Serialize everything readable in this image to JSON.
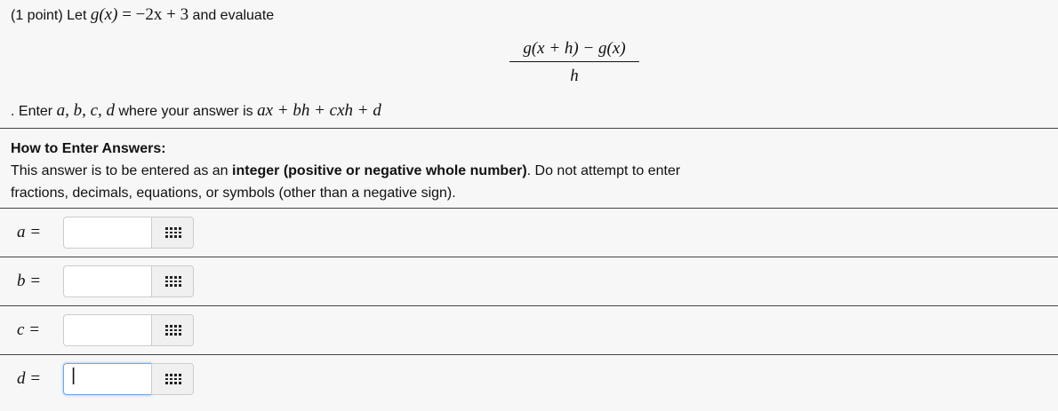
{
  "problem": {
    "points": "(1 point)",
    "let": " Let ",
    "g_x": "g(x)",
    "eq": " = −2x + 3",
    "evaluate": " and evaluate",
    "numerator": "g(x + h) − g(x)",
    "denominator": "h",
    "enter_prefix": ". Enter ",
    "vars": "a, b, c, d",
    "where": " where your answer is ",
    "expr": "ax + bh + cxh + d"
  },
  "howto": {
    "title": "How to Enter Answers:",
    "text1": "This answer is to be entered as an ",
    "bold": "integer (positive or negative whole number)",
    "text2": ". Do not attempt to enter fractions, decimals, equations, or symbols (other than a negative sign)."
  },
  "answers": [
    {
      "label": "a =",
      "value": ""
    },
    {
      "label": "b =",
      "value": ""
    },
    {
      "label": "c =",
      "value": ""
    },
    {
      "label": "d =",
      "value": "|"
    }
  ]
}
